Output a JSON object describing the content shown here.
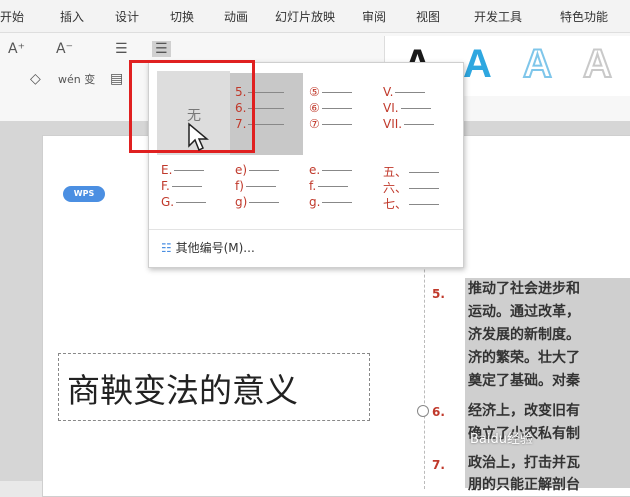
{
  "ribbon": {
    "tabs": [
      "开始",
      "插入",
      "设计",
      "切换",
      "动画",
      "幻灯片放映",
      "审阅",
      "视图",
      "开发工具",
      "特色功能"
    ]
  },
  "toolbar": {
    "font_grow": "A⁺",
    "font_shrink": "A⁻",
    "eraser": "◇",
    "pinyin": "wén 变",
    "bullets": "☰",
    "numbering": "☰",
    "art_letters": [
      "A",
      "A",
      "A",
      "A"
    ],
    "art_colors": [
      "#1a1a1a",
      "#2ea7e0",
      "#7fc6ea",
      "#c9c9c9"
    ]
  },
  "dropdown": {
    "none_label": "无",
    "numbering_styles": [
      [
        "5.",
        "6.",
        "7."
      ],
      [
        "⑤",
        "⑥",
        "⑦"
      ],
      [
        "V.",
        "VI.",
        "VII."
      ],
      [
        "E.",
        "F.",
        "G."
      ],
      [
        "e)",
        "f)",
        "g)"
      ],
      [
        "e.",
        "f.",
        "g."
      ],
      [
        "五、",
        "六、",
        "七、"
      ]
    ],
    "more_label": "其他编号(M)..."
  },
  "slide": {
    "badge": "WPS",
    "title": "商鞅变法的意义",
    "numbers": [
      "5.",
      "6.",
      "7."
    ],
    "paragraph_lines": [
      "推动了社会进步和",
      "运动。通过改革，",
      "济发展的新制度。",
      "济的繁荣。壮大了",
      "奠定了基础。对秦",
      "经济上，改变旧有",
      "确立了小农私有制",
      "政治上，打击并瓦",
      "朋的只能正解剖台"
    ],
    "watermark": "Baidu经验"
  }
}
